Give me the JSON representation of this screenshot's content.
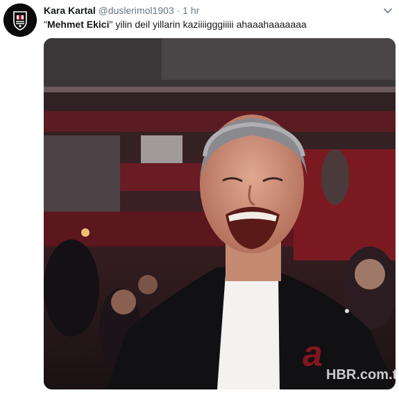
{
  "tweet": {
    "name": "Kara Kartal",
    "handle": "@duslerimol1903",
    "separator": "·",
    "time": "1 hr",
    "text_quote_open": "\"",
    "text_bold": "Mehmet Ekici",
    "text_rest": "\" yilin deil yillarin kaziiiigggiiiii ahaaahaaaaaaa",
    "watermark_logo": "a",
    "watermark": "HBR.com.tr"
  },
  "colors": {
    "name": "#14171a",
    "secondary": "#657786",
    "media_bg": "#1e1416",
    "seats_red": "#7a1a20"
  },
  "icons": {
    "avatar": "besiktas-crest-icon",
    "menu": "chevron-down-icon"
  }
}
